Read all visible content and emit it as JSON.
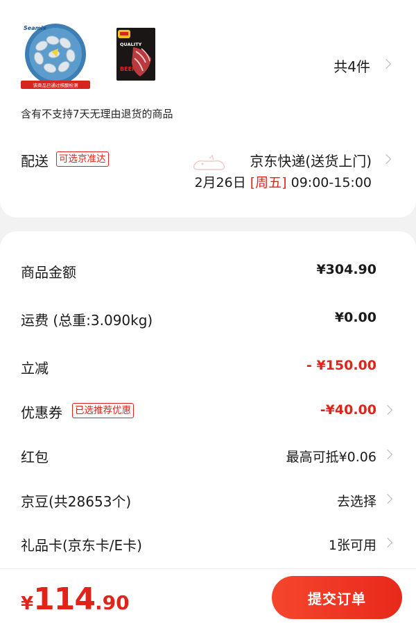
{
  "goods": {
    "shrimp_brand": "Seamix",
    "shrimp_caption": "该商品已通过核酸检测",
    "beef_pack_text": [
      "QUALITY",
      "BEEF"
    ],
    "count_label": "共4件"
  },
  "notice": "含有不支持7天无理由退货的商品",
  "delivery": {
    "label": "配送",
    "tag": "可选京准达",
    "method": "京东快递(送货上门)",
    "date": "2月26日",
    "weekday": "[周五]",
    "time": "09:00-15:00"
  },
  "price": {
    "goods_amount_label": "商品金额",
    "goods_amount": "¥304.90",
    "freight_label": "运费 (总重:3.090kg)",
    "freight": "¥0.00",
    "discount_label": "立减",
    "discount": "- ¥150.00",
    "coupon_label": "优惠券",
    "coupon_tag": "已选推荐优惠",
    "coupon": "-¥40.00",
    "redpacket_label": "红包",
    "redpacket": "最高可抵¥0.06",
    "jingdou_label": "京豆(共28653个)",
    "jingdou": "去选择",
    "giftcard_label": "礼品卡(京东卡/E卡)",
    "giftcard": "1张可用"
  },
  "bottom": {
    "currency": "¥",
    "total_int": "114",
    "total_dec": ".90",
    "submit_label": "提交订单"
  },
  "colors": {
    "accent": "#e2231a",
    "button_start": "#f5462d",
    "button_end": "#e8291b"
  }
}
